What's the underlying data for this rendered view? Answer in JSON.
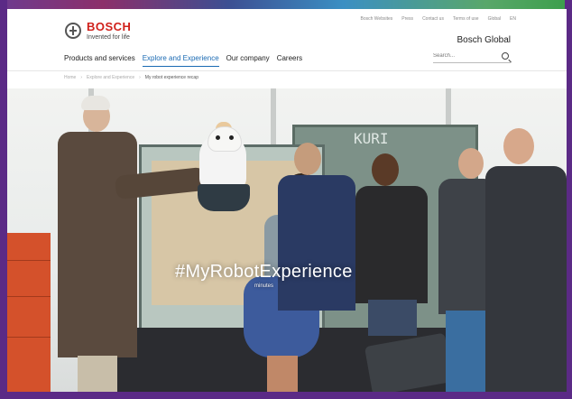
{
  "header": {
    "brand_name": "BOSCH",
    "brand_tagline": "Invented for life",
    "site_name": "Bosch Global",
    "utility_nav": [
      "Bosch Websites",
      "Press",
      "Contact us",
      "Terms of use",
      "Global",
      "EN"
    ],
    "search_placeholder": "Search..."
  },
  "main_nav": {
    "items": [
      {
        "label": "Products and services",
        "active": false
      },
      {
        "label": "Explore and Experience",
        "active": true
      },
      {
        "label": "Our company",
        "active": false
      },
      {
        "label": "Careers",
        "active": false
      }
    ]
  },
  "breadcrumb": [
    "Home",
    "Explore and Experience",
    "My robot experience recap"
  ],
  "hero": {
    "hashtag": "#MyRobotExperience",
    "subtitle": "minutes",
    "board_text": "KURI"
  },
  "colors": {
    "brand_red": "#d0201a",
    "active_nav": "#1a6ab3",
    "frame_purple": "#5b2a86"
  },
  "icons": {
    "logo": "bosch-armature-icon",
    "search": "search-icon"
  }
}
